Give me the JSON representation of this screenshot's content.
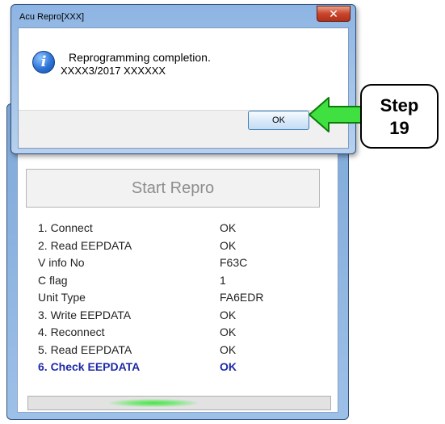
{
  "main_window": {
    "start_button_label": "Start Repro",
    "steps": [
      {
        "label": "1. Connect",
        "value": "OK"
      },
      {
        "label": "2. Read EEPDATA",
        "value": "OK"
      },
      {
        "label": "V info No",
        "value": "F63C"
      },
      {
        "label": "C flag",
        "value": "1"
      },
      {
        "label": "Unit Type",
        "value": "FA6EDR"
      },
      {
        "label": "3. Write EEPDATA",
        "value": "OK"
      },
      {
        "label": "4. Reconnect",
        "value": "OK"
      },
      {
        "label": "5. Read EEPDATA",
        "value": "OK"
      },
      {
        "label": "6. Check EEPDATA",
        "value": "OK"
      }
    ],
    "highlight_color": "#1f2aa7",
    "progress_color": "#4fe04f"
  },
  "dialog": {
    "title": "Acu Repro[XXX]",
    "close_symbol": "✕",
    "icon": "info-icon",
    "message_line1": "Reprogramming completion.",
    "message_line2": "XXXX3/2017 XXXXXX",
    "ok_label": "OK"
  },
  "callout": {
    "line1": "Step",
    "line2": "19",
    "arrow_color": "#3fe03f"
  }
}
